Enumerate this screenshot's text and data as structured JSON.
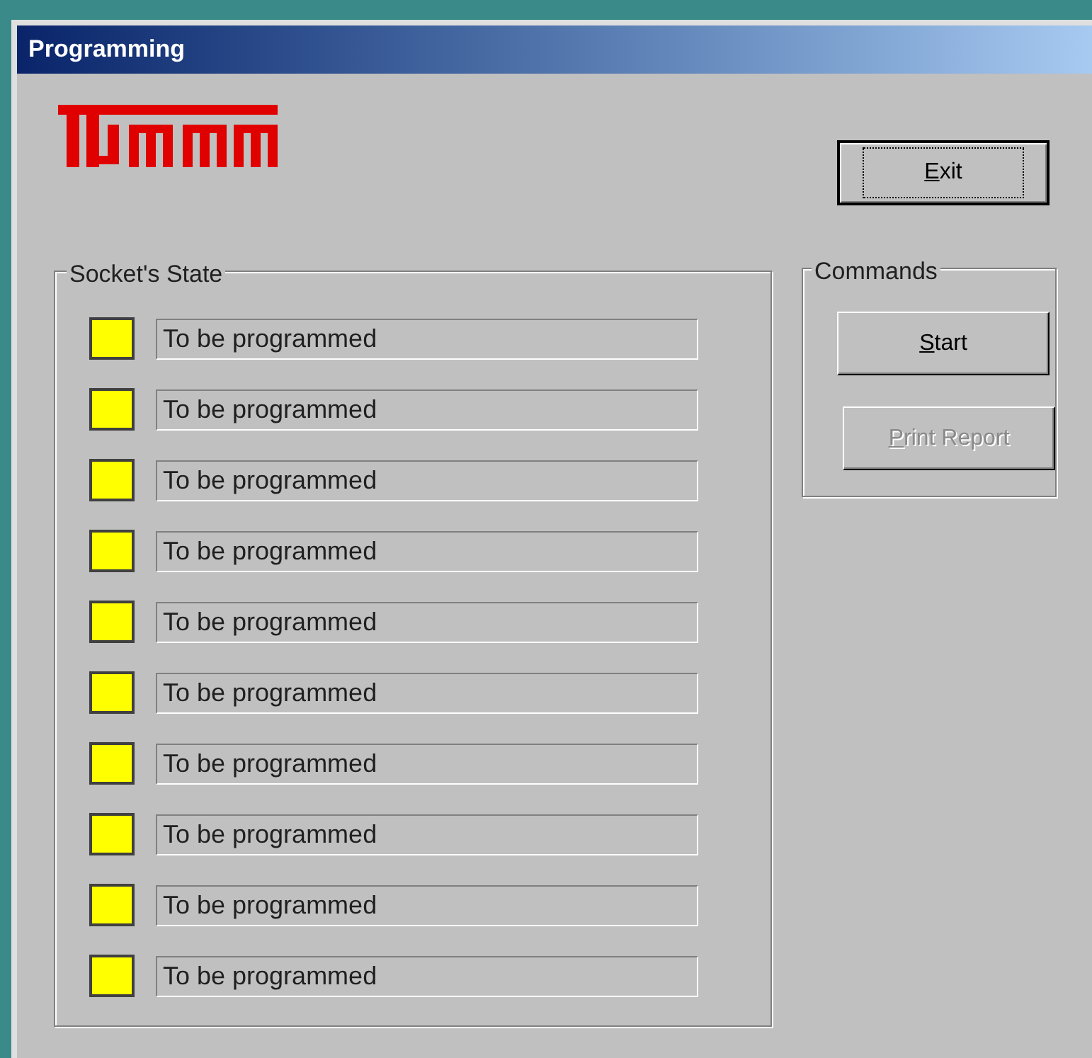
{
  "window": {
    "title": "Programming"
  },
  "exit_button": {
    "label": "Exit",
    "first_letter_underlined": true,
    "focused": true
  },
  "socket_state": {
    "title": "Socket's State",
    "sockets": [
      {
        "status": "To be programmed",
        "color": "#ffff00"
      },
      {
        "status": "To be programmed",
        "color": "#ffff00"
      },
      {
        "status": "To be programmed",
        "color": "#ffff00"
      },
      {
        "status": "To be programmed",
        "color": "#ffff00"
      },
      {
        "status": "To be programmed",
        "color": "#ffff00"
      },
      {
        "status": "To be programmed",
        "color": "#ffff00"
      },
      {
        "status": "To be programmed",
        "color": "#ffff00"
      },
      {
        "status": "To be programmed",
        "color": "#ffff00"
      },
      {
        "status": "To be programmed",
        "color": "#ffff00"
      },
      {
        "status": "To be programmed",
        "color": "#ffff00"
      }
    ]
  },
  "commands": {
    "title": "Commands",
    "buttons": [
      {
        "label": "Start",
        "first_letter_underlined": true,
        "disabled": false
      },
      {
        "label": "Print Report",
        "first_letter_underlined": true,
        "disabled": true
      }
    ]
  }
}
